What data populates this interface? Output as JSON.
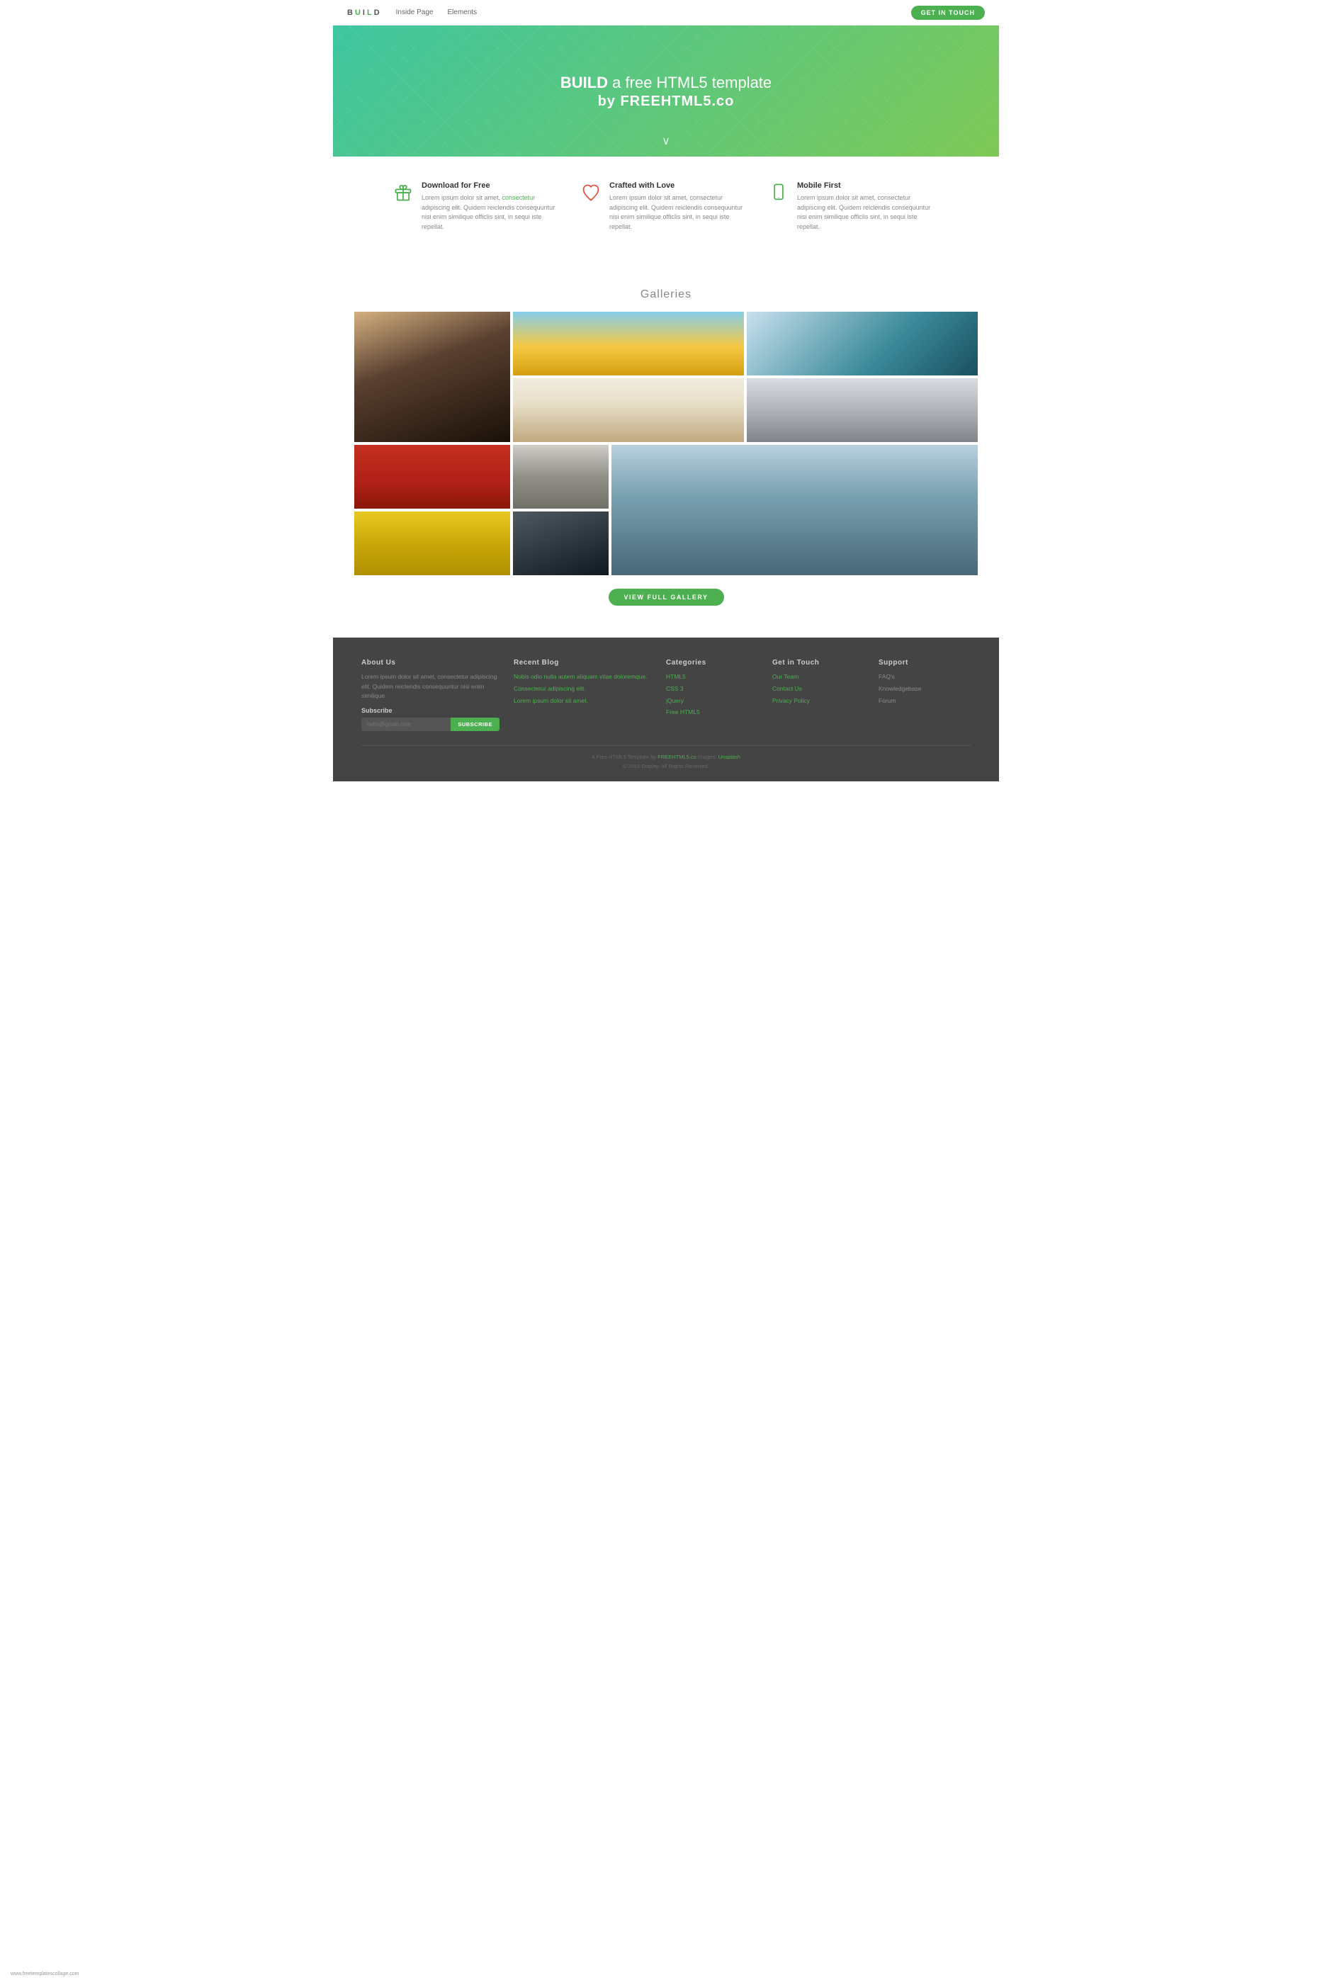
{
  "navbar": {
    "brand": "BUILD",
    "links": [
      "Inside Page",
      "Elements"
    ],
    "cta": "GET IN TOUCH"
  },
  "hero": {
    "line1_prefix": "",
    "line1_bold": "BUILD",
    "line1_suffix": " a free HTML5 template",
    "line2": "by FREEHTML5.co",
    "arrow": "∨"
  },
  "features": [
    {
      "icon": "gift",
      "title": "Download for Free",
      "text": "Lorem ipsum dolor sit amet, ",
      "link": "consectetur",
      "text2": " adipiscing elit. Quidem reiclendis consequuntur nisi enim similique officlis sint, in sequi iste repellat."
    },
    {
      "icon": "heart",
      "title": "Crafted with Love",
      "text": "Lorem ipsum dolor sit amet, consectetur adipiscing elit. Quidem reiclendis consequuntur nisi enim similique officlis sint, in sequi iste repellat."
    },
    {
      "icon": "mobile",
      "title": "Mobile First",
      "text": "Lorem ipsum dolor sit amet, consectetur adipiscing elit. Quidem reiclendis consequuntur nisi enim similique officlis sint, in sequi iste repellat."
    }
  ],
  "galleries": {
    "title": "Galleries",
    "view_btn": "VIEW FULL GALLERY"
  },
  "footer": {
    "about": {
      "title": "About Us",
      "text": "Lorem ipsum dolor sit amet, consectetur adipiscing elit. Quidem reiclendis consequuntur nisi enim similique"
    },
    "subscribe": {
      "title": "Subscribe",
      "placeholder": "hello@gmail.com",
      "btn": "SUBSCRIBE"
    },
    "blog": {
      "title": "Recent Blog",
      "links": [
        "Nobis odio nulla autem aliquam vitae doloremque.",
        "Consectetur adipiscing elit.",
        "Lorem ipsum dolor sit amet."
      ]
    },
    "categories": {
      "title": "Categories",
      "links": [
        "HTML5",
        "CSS 3",
        "jQuery",
        "Free HTML5"
      ]
    },
    "get_in_touch": {
      "title": "Get in Touch",
      "links": [
        "Our Team",
        "Contact Us",
        "Privacy Policy"
      ]
    },
    "support": {
      "title": "Support",
      "links": [
        "FAQ's",
        "Knowledgebase",
        "Forum"
      ]
    },
    "bottom": {
      "text1": "A Free HTML5 Template by ",
      "brand": "FREEHTML5.co",
      "text2": " Images: ",
      "unsplash": "Unsplash",
      "copy": "© 2015 Display. All Rights Reserved."
    },
    "url": "www.freetemplatescollage.com"
  }
}
